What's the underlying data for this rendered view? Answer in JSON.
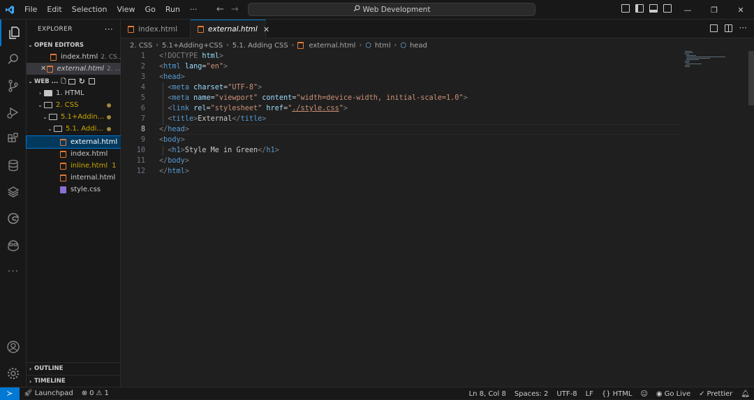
{
  "titlebar": {
    "menu": [
      "File",
      "Edit",
      "Selection",
      "View",
      "Go",
      "Run",
      "···"
    ],
    "search": "Web Development"
  },
  "explorer": {
    "title": "EXPLORER",
    "more": "···",
    "open_editors_label": "OPEN EDITORS",
    "open_editors": [
      {
        "name": "index.html",
        "detail": "2. CS..."
      },
      {
        "name": "external.html",
        "detail": "2. ..."
      }
    ],
    "workspace_label": "WEB ...",
    "tree": [
      {
        "name": "1. HTML"
      },
      {
        "name": "2. CSS"
      },
      {
        "name": "5.1+Addin..."
      },
      {
        "name": "5.1. Addi..."
      },
      {
        "name": "external.html"
      },
      {
        "name": "index.html"
      },
      {
        "name": "inline.html",
        "badge": "1"
      },
      {
        "name": "internal.html"
      },
      {
        "name": "style.css"
      }
    ],
    "outline_label": "OUTLINE",
    "timeline_label": "TIMELINE"
  },
  "tabs": [
    {
      "label": "index.html"
    },
    {
      "label": "external.html"
    }
  ],
  "breadcrumb": [
    "2. CSS",
    "5.1+Adding+CSS",
    "5.1. Adding CSS",
    "external.html",
    "html",
    "head"
  ],
  "editor": {
    "line_numbers": [
      "1",
      "2",
      "3",
      "4",
      "5",
      "6",
      "7",
      "8",
      "9",
      "10",
      "11",
      "12"
    ],
    "current_line": "8",
    "tokens": {
      "l1_a": "<!DOCTYPE",
      "l1_b": "html",
      "l1_c": ">",
      "lt": "<",
      "gt": ">",
      "lt_close": "</",
      "html": "html",
      "head": "head",
      "meta": "meta",
      "link": "link",
      "title": "title",
      "body": "body",
      "h1": "h1",
      "lang": "lang",
      "lang_val": "\"en\"",
      "charset": "charset",
      "charset_val": "\"UTF-8\"",
      "name": "name",
      "name_val": "\"viewport\"",
      "content": "content",
      "content_val": "\"width=device-width, initial-scale=1.0\"",
      "rel": "rel",
      "rel_val": "\"stylesheet\"",
      "href": "href",
      "quote": "\"",
      "href_val": "./style.css",
      "eq": "=",
      "title_text": "External",
      "h1_text": "Style Me in Green"
    }
  },
  "statusbar": {
    "launchpad": "Launchpad",
    "errors": "0",
    "warnings": "1",
    "position": "Ln 8, Col 8",
    "spaces": "Spaces: 2",
    "encoding": "UTF-8",
    "eol": "LF",
    "language": "HTML",
    "golive": "Go Live",
    "prettier": "Prettier"
  }
}
